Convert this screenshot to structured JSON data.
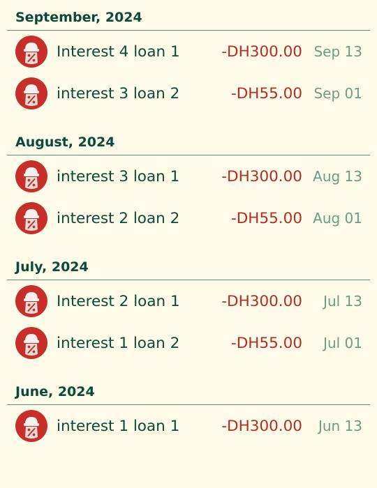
{
  "colors": {
    "background": "#FEFCE8",
    "heading": "#0B4A3A",
    "amount_negative": "#B32C26",
    "date": "#6E9A86",
    "divider": "#5F8A77",
    "icon_circle": "#C62F2A"
  },
  "groups": [
    {
      "title": "September, 2024",
      "items": [
        {
          "name": "Interest 4 loan 1",
          "amount": "-DH300.00",
          "date": "Sep 13",
          "icon": "loan-interest-icon"
        },
        {
          "name": "interest 3 loan 2",
          "amount": "-DH55.00",
          "date": "Sep 01",
          "icon": "loan-interest-icon"
        }
      ]
    },
    {
      "title": "August, 2024",
      "items": [
        {
          "name": "interest 3 loan 1",
          "amount": "-DH300.00",
          "date": "Aug 13",
          "icon": "loan-interest-icon"
        },
        {
          "name": "interest 2 loan 2",
          "amount": "-DH55.00",
          "date": "Aug 01",
          "icon": "loan-interest-icon"
        }
      ]
    },
    {
      "title": "July, 2024",
      "items": [
        {
          "name": "Interest 2 loan 1",
          "amount": "-DH300.00",
          "date": "Jul 13",
          "icon": "loan-interest-icon"
        },
        {
          "name": "interest 1 loan 2",
          "amount": "-DH55.00",
          "date": "Jul 01",
          "icon": "loan-interest-icon"
        }
      ]
    },
    {
      "title": "June, 2024",
      "items": [
        {
          "name": "interest 1 loan 1",
          "amount": "-DH300.00",
          "date": "Jun 13",
          "icon": "loan-interest-icon"
        }
      ]
    }
  ]
}
